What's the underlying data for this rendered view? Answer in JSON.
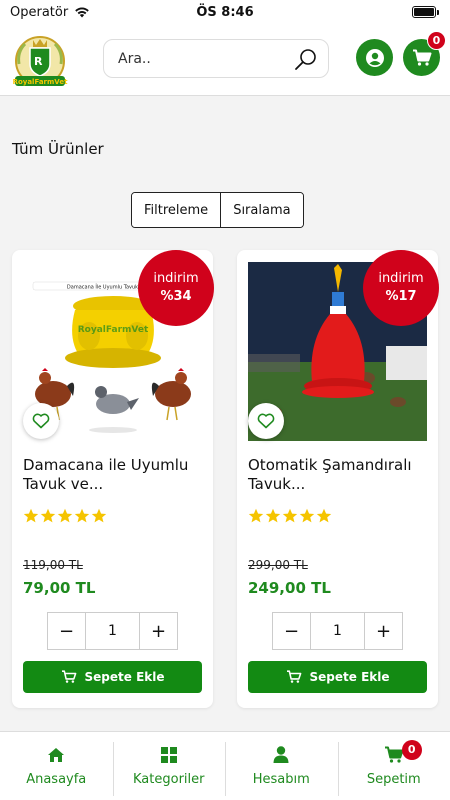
{
  "status_bar": {
    "carrier": "Operatör",
    "time": "ÖS 8:46"
  },
  "header": {
    "logo_text": "RoyalFarmVet",
    "search_placeholder": "Ara..",
    "cart_count": "0"
  },
  "page": {
    "title": "Tüm Ürünler",
    "filter_label": "Filtreleme",
    "sort_label": "Sıralama"
  },
  "products": [
    {
      "name": "Damacana ile Uyumlu Tavuk ve...",
      "image_caption": "Damacana İle Uyumlu Tavuk ve Gü...",
      "image_brand": "RoyalFarmVet",
      "discount_label": "indirim",
      "discount_value": "%34",
      "rating": 5,
      "old_price": "119,00 TL",
      "new_price": "79,00 TL",
      "quantity": "1",
      "add_to_cart": "Sepete Ekle"
    },
    {
      "name": "Otomatik Şamandıralı Tavuk...",
      "discount_label": "indirim",
      "discount_value": "%17",
      "rating": 5,
      "old_price": "299,00 TL",
      "new_price": "249,00 TL",
      "quantity": "1",
      "add_to_cart": "Sepete Ekle"
    }
  ],
  "bottom_nav": {
    "home": "Anasayfa",
    "categories": "Kategoriler",
    "account": "Hesabım",
    "cart": "Sepetim",
    "cart_count": "0"
  },
  "colors": {
    "brand_green": "#1f8a1f",
    "discount_red": "#d0021b",
    "star_yellow": "#f5c400"
  }
}
